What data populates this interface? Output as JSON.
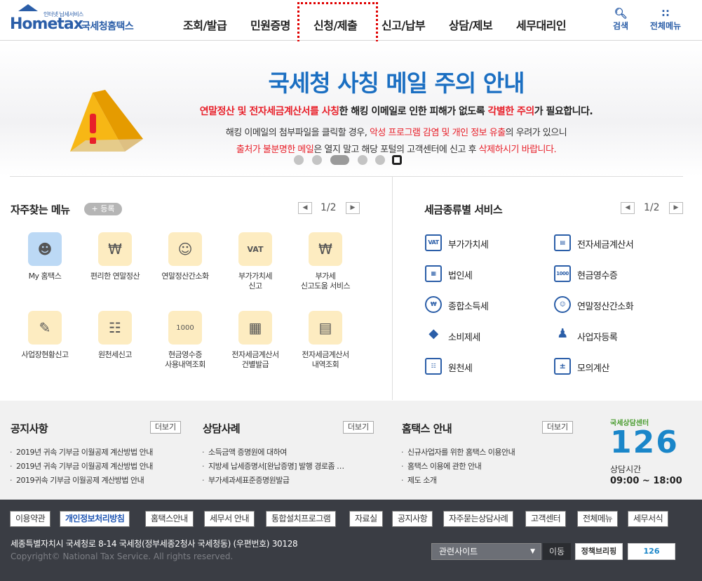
{
  "header": {
    "logo_tiny": "인터넷 납세서비스",
    "logo_word": "Hometax",
    "logo_name": "국세청홈택스",
    "nav": [
      "조회/발급",
      "민원증명",
      "신청/제출",
      "신고/납부",
      "상담/제보",
      "세무대리인"
    ],
    "search_label": "검색",
    "allmenu_label": "전체메뉴"
  },
  "banner": {
    "title": "국세청 사칭 메일 주의 안내",
    "line1": {
      "r1": "연말정산 및 전자세금계산서를 사칭",
      "t1": "한 해킹 이메일로 인한 피해가 없도록 ",
      "r2": "각별한 주의",
      "t2": "가 필요합니다."
    },
    "line2": {
      "t1": "해킹 이메일의 첨부파일을 클릭할 경우, ",
      "r1": "악성 프로그램 감염 및 개인 정보 유출",
      "t2": "의 우려가 있으니"
    },
    "line3": {
      "r1": "출처가 불분명한 메일",
      "t1": "은 열지 말고 해당 포털의 고객센터에 신고 후 ",
      "r2": "삭제하시기 바랍니다."
    },
    "slide_count": 6,
    "active_slide": 3,
    "color_title": "#1b6fc2",
    "color_red": "#e8202a"
  },
  "favorites": {
    "title": "자주찾는 메뉴",
    "add_label": "+ 등록",
    "page": "1/2",
    "items": [
      {
        "label": "My 홈택스",
        "icon": "user-icon"
      },
      {
        "label": "편리한 연말정산",
        "icon": "tax-settle-icon"
      },
      {
        "label": "연말정산간소화",
        "icon": "simplified-icon"
      },
      {
        "label": "부가가치세\n신고",
        "icon": "vat-icon"
      },
      {
        "label": "부가세\n신고도움 서비스",
        "icon": "vat-help-icon"
      },
      {
        "label": "사업장현황신고",
        "icon": "business-report-icon"
      },
      {
        "label": "원천세신고",
        "icon": "withholding-icon"
      },
      {
        "label": "현금영수증\n사용내역조회",
        "icon": "cash-receipt-icon"
      },
      {
        "label": "전자세금계산서\n건별발급",
        "icon": "einvoice-issue-icon"
      },
      {
        "label": "전자세금계산서\n내역조회",
        "icon": "einvoice-lookup-icon"
      }
    ]
  },
  "taxservice": {
    "title": "세금종류별 서비스",
    "page": "1/2",
    "items": [
      {
        "label": "부가가치세",
        "icon": "vat-icon"
      },
      {
        "label": "전자세금계산서",
        "icon": "einvoice-icon"
      },
      {
        "label": "법인세",
        "icon": "corporate-tax-icon"
      },
      {
        "label": "현금영수증",
        "icon": "cash-receipt-icon"
      },
      {
        "label": "종합소득세",
        "icon": "income-tax-icon"
      },
      {
        "label": "연말정산간소화",
        "icon": "year-end-icon"
      },
      {
        "label": "소비제세",
        "icon": "consumption-tax-icon"
      },
      {
        "label": "사업자등록",
        "icon": "business-reg-icon"
      },
      {
        "label": "원천세",
        "icon": "withholding-icon"
      },
      {
        "label": "모의계산",
        "icon": "calculator-icon"
      }
    ]
  },
  "notices": [
    {
      "title": "공지사항",
      "more": "더보기",
      "items": [
        "2019년 귀속 기부금 이월공제 계산방법 안내",
        "2019년 귀속 기부금 이월공제 계산방법 안내",
        "2019귀속 기부금 이월공제 계산방법 안내"
      ]
    },
    {
      "title": "상담사례",
      "more": "더보기",
      "items": [
        "소득금액 증명원에 대하여",
        "지방세 납세증명서[완납증명] 발행 경로좀 …",
        "부가세과세표준증명원발급"
      ]
    },
    {
      "title": "홈택스 안내",
      "more": "더보기",
      "items": [
        "신규사업자를 위한 홈택스 이용안내",
        "홈택스 이용에 관한 안내",
        "제도 소개"
      ]
    }
  ],
  "center126": {
    "label_top": "국세상담센터",
    "digits": "126",
    "hours_label": "상담시간",
    "hours": "09:00 ~ 18:00"
  },
  "footer": {
    "links": [
      "이용약관",
      "개인정보처리방침",
      "홈택스안내",
      "세무서 안내",
      "통합설치프로그램",
      "자료실",
      "공지사항",
      "자주묻는상담사례",
      "고객센터",
      "전체메뉴",
      "세무서식"
    ],
    "address": "세종특별자치시 국세청로 8-14 국세청(정부세종2청사 국세청동) (우편번호) 30128",
    "copyright": "Copyright© National Tax Service. All rights reserved.",
    "related_site": "관련사이트",
    "go_label": "이동",
    "banner1": "정책브리핑",
    "banner2": "126"
  }
}
